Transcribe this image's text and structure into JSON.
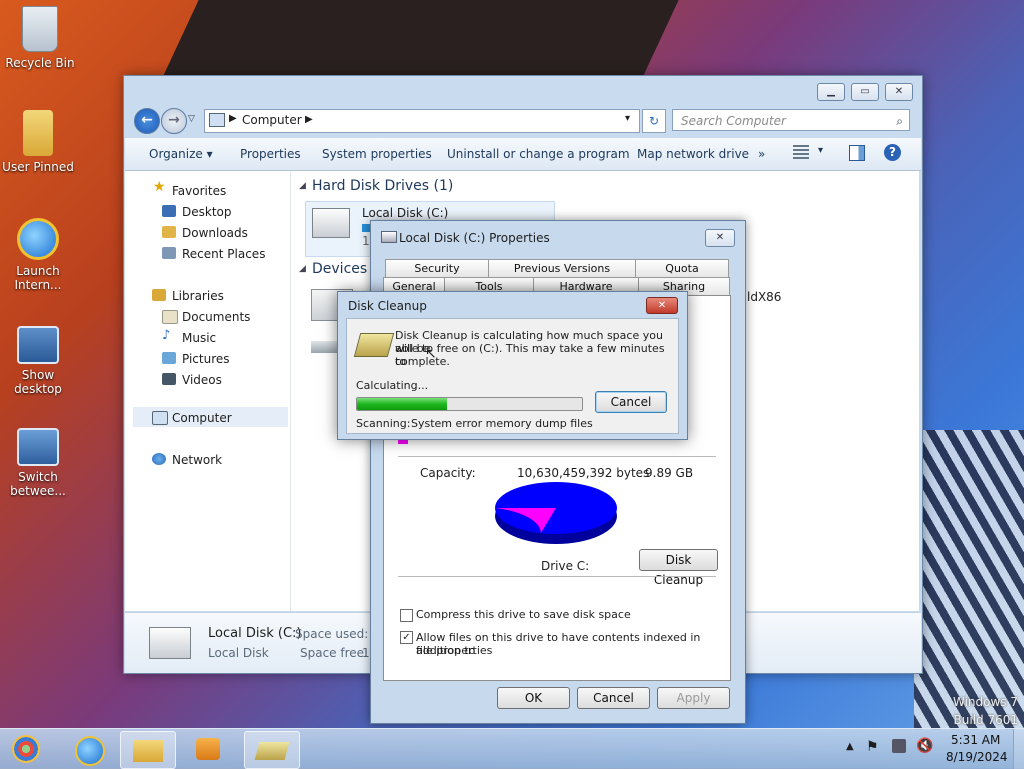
{
  "desktop": {
    "icons": [
      {
        "label": "Recycle Bin"
      },
      {
        "label": "User Pinned"
      },
      {
        "label": "Launch Intern..."
      },
      {
        "label": "Show desktop"
      },
      {
        "label": "Switch betwee..."
      }
    ],
    "watermark": {
      "line1": "Windows 7",
      "line2": "Build 7601"
    }
  },
  "explorer": {
    "address": {
      "computer": "Computer"
    },
    "search_placeholder": "Search Computer",
    "toolbar": {
      "organize": "Organize ▾",
      "properties": "Properties",
      "system_properties": "System properties",
      "uninstall": "Uninstall or change a program",
      "map_drive": "Map network drive",
      "more": "»"
    },
    "nav": {
      "favorites": "Favorites",
      "desktop": "Desktop",
      "downloads": "Downloads",
      "recent_places": "Recent Places",
      "libraries": "Libraries",
      "documents": "Documents",
      "music": "Music",
      "pictures": "Pictures",
      "videos": "Videos",
      "computer": "Computer",
      "network": "Network"
    },
    "content": {
      "hdd_header": "Hard Disk Drives (1)",
      "drive_label": "Local Disk (C:)",
      "drive_sub": "1.",
      "devices_header": "Devices w",
      "partial_text": "ldX86"
    },
    "details": {
      "name": "Local Disk (C:)",
      "type": "Local Disk",
      "space_used_label": "Space used:",
      "space_free_label": "Space free:",
      "space_free_val": "1."
    }
  },
  "properties": {
    "title": "Local Disk (C:) Properties",
    "tabs_row1": [
      "Security",
      "Previous Versions",
      "Quota"
    ],
    "tabs_row2": [
      "General",
      "Tools",
      "Hardware",
      "Sharing"
    ],
    "capacity_label": "Capacity:",
    "capacity_bytes": "10,630,459,392 bytes",
    "capacity_gb": "9.89 GB",
    "drive_name": "Drive C:",
    "disk_cleanup_button": "Disk Cleanup",
    "compress_label": "Compress this drive to save disk space",
    "compress_checked": false,
    "index_label_1": "Allow files on this drive to have contents indexed in addition to",
    "index_label_2": "file properties",
    "index_checked": true,
    "ok": "OK",
    "cancel": "Cancel",
    "apply": "Apply",
    "used_fraction": 0.21,
    "colors": {
      "used": "#ff00ff",
      "free": "#0000ff"
    }
  },
  "disk_cleanup": {
    "title": "Disk Cleanup",
    "message_1": "Disk Cleanup is calculating how much space you will be",
    "message_2": "able to free on  (C:). This may take a few minutes to",
    "message_3": "complete.",
    "status": "Calculating...",
    "progress": 0.4,
    "cancel": "Cancel",
    "scanning_label": "Scanning:",
    "scanning_item": "System error memory dump files"
  },
  "taskbar": {
    "time": "5:31 AM",
    "date": "8/19/2024"
  }
}
